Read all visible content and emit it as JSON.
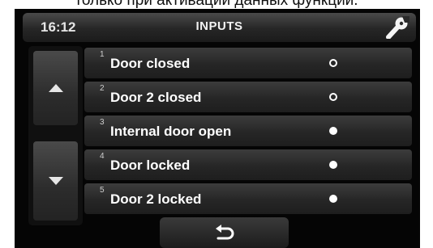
{
  "caption": "только при активации данных функций.",
  "header": {
    "time": "16:12",
    "title": "INPUTS",
    "icon": "wrench-icon"
  },
  "scroll": {
    "up_icon": "arrow-up-icon",
    "down_icon": "arrow-down-icon"
  },
  "inputs": [
    {
      "number": "1",
      "label": "Door closed",
      "state": "off"
    },
    {
      "number": "2",
      "label": "Door 2 closed",
      "state": "off"
    },
    {
      "number": "3",
      "label": "Internal door open",
      "state": "on"
    },
    {
      "number": "4",
      "label": "Door locked",
      "state": "on"
    },
    {
      "number": "5",
      "label": "Door 2 locked",
      "state": "on"
    }
  ],
  "footer": {
    "back_icon": "back-arrow-icon"
  },
  "colors": {
    "background": "#050505",
    "text": "#ffffff",
    "indicator": "#ffffff"
  }
}
